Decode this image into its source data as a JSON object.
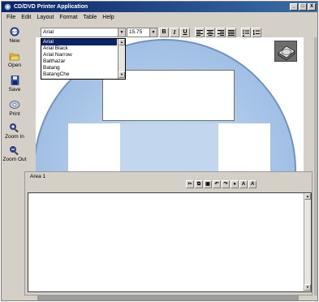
{
  "window": {
    "title": "CD/DVD Printer Application",
    "controls": [
      "_",
      "□",
      "X"
    ]
  },
  "menu": [
    "File",
    "Edit",
    "Layout",
    "Format",
    "Table",
    "Help"
  ],
  "sidebar": {
    "tools": [
      {
        "label": "New",
        "icon": "new-disc-icon"
      },
      {
        "label": "Open",
        "icon": "open-folder-icon"
      },
      {
        "label": "Save",
        "icon": "save-disk-icon"
      },
      {
        "label": "Print",
        "icon": "print-disc-icon"
      },
      {
        "label": "Zoom In",
        "icon": "zoom-in-icon"
      },
      {
        "label": "Zoom Out",
        "icon": "zoom-out-icon"
      }
    ]
  },
  "format_toolbar": {
    "font": "Arial",
    "size": "15.75",
    "bold": "B",
    "italic": "I",
    "underline": "U"
  },
  "font_list": {
    "options": [
      "Arial",
      "Arial Black",
      "Arial Narrow",
      "Balthazar",
      "Batang",
      "BatangChe"
    ],
    "selected": "Arial"
  },
  "area_panel": {
    "label": "Area 1",
    "text_color_label": "A",
    "text_style_label": "A"
  },
  "colors": {
    "titlebar_start": "#0a246a",
    "titlebar_end": "#3a6ea5",
    "disc": "#a9c6e8",
    "hub": "#3446a8",
    "hub_inner": "#a48bd0"
  }
}
